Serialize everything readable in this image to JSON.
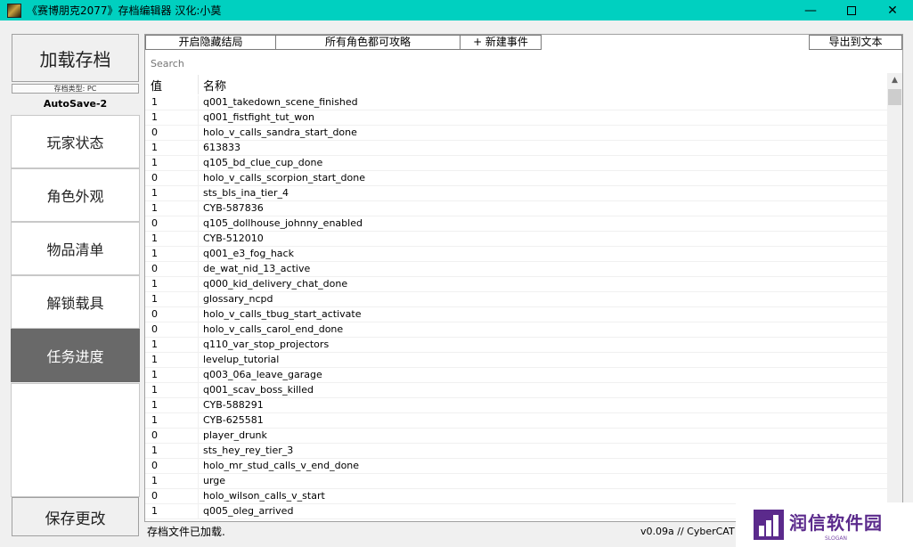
{
  "window": {
    "title": "《赛博朋克2077》存档编辑器 汉化:小莫",
    "min_glyph": "—",
    "close_glyph": "✕"
  },
  "sidebar": {
    "load_button": "加载存档",
    "save_type": "存档类型: PC",
    "save_name": "AutoSave-2",
    "items": [
      {
        "label": "玩家状态"
      },
      {
        "label": "角色外观"
      },
      {
        "label": "物品清单"
      },
      {
        "label": "解锁载具"
      },
      {
        "label": "任务进度"
      }
    ],
    "active_index": 4,
    "save_changes": "保存更改"
  },
  "toolbar": {
    "hidden_ending": "开启隐藏结局",
    "all_romance": "所有角色都可攻略",
    "new_event": "+ 新建事件",
    "export_text": "导出到文本"
  },
  "search": {
    "placeholder": "Search"
  },
  "table": {
    "columns": {
      "value": "值",
      "name": "名称"
    },
    "rows": [
      {
        "value": "1",
        "name": "q001_takedown_scene_finished"
      },
      {
        "value": "1",
        "name": "q001_fistfight_tut_won"
      },
      {
        "value": "0",
        "name": "holo_v_calls_sandra_start_done"
      },
      {
        "value": "1",
        "name": "613833"
      },
      {
        "value": "1",
        "name": "q105_bd_clue_cup_done"
      },
      {
        "value": "0",
        "name": "holo_v_calls_scorpion_start_done"
      },
      {
        "value": "1",
        "name": "sts_bls_ina_tier_4"
      },
      {
        "value": "1",
        "name": "CYB-587836"
      },
      {
        "value": "0",
        "name": "q105_dollhouse_johnny_enabled"
      },
      {
        "value": "1",
        "name": "CYB-512010"
      },
      {
        "value": "1",
        "name": "q001_e3_fog_hack"
      },
      {
        "value": "0",
        "name": "de_wat_nid_13_active"
      },
      {
        "value": "1",
        "name": "q000_kid_delivery_chat_done"
      },
      {
        "value": "1",
        "name": "glossary_ncpd"
      },
      {
        "value": "0",
        "name": "holo_v_calls_tbug_start_activate"
      },
      {
        "value": "0",
        "name": "holo_v_calls_carol_end_done"
      },
      {
        "value": "1",
        "name": "q110_var_stop_projectors"
      },
      {
        "value": "1",
        "name": "levelup_tutorial"
      },
      {
        "value": "1",
        "name": "q003_06a_leave_garage"
      },
      {
        "value": "1",
        "name": "q001_scav_boss_killed"
      },
      {
        "value": "1",
        "name": "CYB-588291"
      },
      {
        "value": "1",
        "name": "CYB-625581"
      },
      {
        "value": "0",
        "name": "player_drunk"
      },
      {
        "value": "1",
        "name": "sts_hey_rey_tier_3"
      },
      {
        "value": "0",
        "name": "holo_mr_stud_calls_v_end_done"
      },
      {
        "value": "1",
        "name": "urge"
      },
      {
        "value": "0",
        "name": "holo_wilson_calls_v_start"
      },
      {
        "value": "1",
        "name": "q005_oleg_arrived"
      }
    ]
  },
  "status": {
    "message": "存档文件已加载.",
    "version": "v0.09a // CyberCAT by"
  },
  "watermark": {
    "title": "润信软件园",
    "slogan": "SLOGAN"
  },
  "colors": {
    "titlebar": "#00d0c0",
    "active_nav": "#696969",
    "watermark": "#5b2a8c"
  }
}
